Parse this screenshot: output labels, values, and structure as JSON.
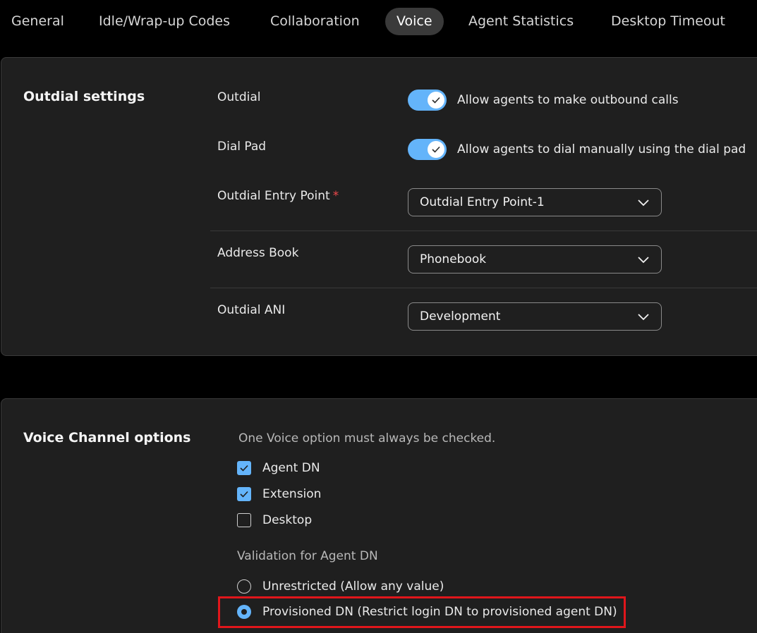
{
  "tabs": [
    {
      "label": "General",
      "active": false
    },
    {
      "label": "Idle/Wrap-up Codes",
      "active": false
    },
    {
      "label": "Collaboration",
      "active": false
    },
    {
      "label": "Voice",
      "active": true
    },
    {
      "label": "Agent Statistics",
      "active": false
    },
    {
      "label": "Desktop Timeout",
      "active": false
    }
  ],
  "outdial": {
    "title": "Outdial settings",
    "outdial_label": "Outdial",
    "outdial_toggle_on": true,
    "outdial_toggle_text": "Allow agents to make outbound calls",
    "dialpad_label": "Dial Pad",
    "dialpad_toggle_on": true,
    "dialpad_toggle_text": "Allow agents to dial manually using the dial pad",
    "entry_point_label": "Outdial Entry Point",
    "required_mark": "*",
    "entry_point_value": "Outdial Entry Point-1",
    "address_book_label": "Address Book",
    "address_book_value": "Phonebook",
    "ani_label": "Outdial ANI",
    "ani_value": "Development"
  },
  "voice": {
    "title": "Voice Channel options",
    "hint": "One Voice option must always be checked.",
    "options": [
      {
        "label": "Agent DN",
        "checked": true
      },
      {
        "label": "Extension",
        "checked": true
      },
      {
        "label": "Desktop",
        "checked": false
      }
    ],
    "validation_label": "Validation for Agent DN",
    "validation_options": [
      {
        "label": "Unrestricted (Allow any value)",
        "selected": false
      },
      {
        "label": "Provisioned DN (Restrict login DN to provisioned agent DN)",
        "selected": true
      }
    ]
  },
  "colors": {
    "accent": "#64b4fa",
    "highlight": "#e0161b",
    "required": "#f0494c"
  },
  "icons": {
    "toggle_check": "check-icon",
    "select_chevron": "chevron-down-icon",
    "checkbox_check": "check-icon"
  }
}
